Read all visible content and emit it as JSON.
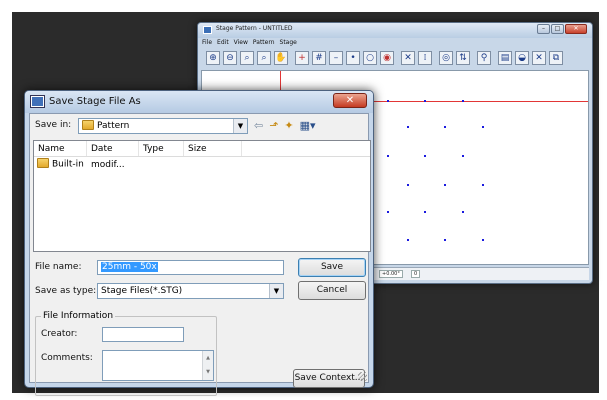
{
  "bg_window": {
    "title": "Stage Pattern - UNTITLED",
    "menu": [
      "File",
      "Edit",
      "View",
      "Pattern",
      "Stage"
    ],
    "toolbar_icons": [
      "zoom-in-icon",
      "zoom-out-icon",
      "zoom-fit-icon",
      "zoom-area-icon",
      "pan-icon",
      "add-point-icon",
      "grid-icon",
      "line-icon",
      "center-icon",
      "circle-icon",
      "target-icon",
      "delete-icon",
      "array-icon",
      "ring-icon",
      "flip-icon",
      "stage-icon",
      "export-icon",
      "eye-icon",
      "cancel-icon",
      "copy-icon"
    ],
    "status": {
      "angle": "+0.00°",
      "count": "0"
    }
  },
  "dialog": {
    "title": "Save Stage File As",
    "close_label": "✕",
    "save_in_label": "Save in:",
    "save_in_value": "Pattern",
    "columns": [
      "Name",
      "Date modif...",
      "Type",
      "Size"
    ],
    "files": [
      {
        "name": "Built-in"
      }
    ],
    "file_name_label": "File name:",
    "file_name_value": "25mm - 50x",
    "save_as_type_label": "Save as type:",
    "save_as_type_value": "Stage Files(*.STG)",
    "save_button": "Save",
    "cancel_button": "Cancel",
    "file_info_legend": "File Information",
    "creator_label": "Creator:",
    "creator_value": "",
    "comments_label": "Comments:",
    "comments_value": "",
    "save_context_button": "Save Context..."
  }
}
